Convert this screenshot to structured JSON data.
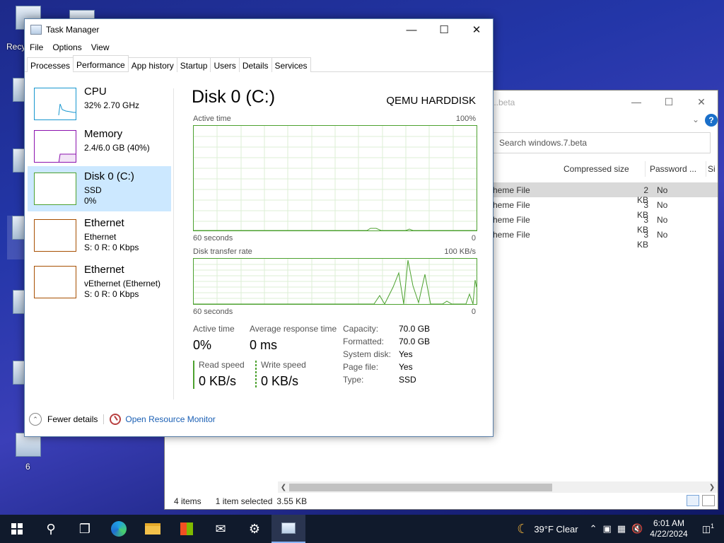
{
  "desktop": {
    "icons": [
      {
        "label": "Recy"
      },
      {
        "label": "6"
      }
    ]
  },
  "explorer": {
    "title": "...beta",
    "search_placeholder": "Search windows.7.beta",
    "columns": [
      "Compressed size",
      "Password ...",
      "Si"
    ],
    "rows": [
      {
        "type": "heme File",
        "size": "2 KB",
        "password": "No"
      },
      {
        "type": "heme File",
        "size": "3 KB",
        "password": "No"
      },
      {
        "type": "heme File",
        "size": "3 KB",
        "password": "No"
      },
      {
        "type": "heme File",
        "size": "3 KB",
        "password": "No"
      }
    ],
    "status": {
      "items": "4 items",
      "selected": "1 item selected",
      "size": "3.55 KB"
    }
  },
  "taskmanager": {
    "title": "Task Manager",
    "menu": [
      "File",
      "Options",
      "View"
    ],
    "tabs": [
      "Processes",
      "Performance",
      "App history",
      "Startup",
      "Users",
      "Details",
      "Services"
    ],
    "active_tab": "Performance",
    "sidebar": [
      {
        "name": "CPU",
        "line1": "32%  2.70 GHz",
        "line2": "",
        "color": "#1796cf"
      },
      {
        "name": "Memory",
        "line1": "2.4/6.0 GB (40%)",
        "line2": "",
        "color": "#8b12ae"
      },
      {
        "name": "Disk 0 (C:)",
        "line1": "SSD",
        "line2": "0%",
        "color": "#4ca12f"
      },
      {
        "name": "Ethernet",
        "line1": "Ethernet",
        "line2": "S: 0  R: 0 Kbps",
        "color": "#a74f01"
      },
      {
        "name": "Ethernet",
        "line1": "vEthernet (Ethernet)",
        "line2": "S: 0  R: 0 Kbps",
        "color": "#a74f01"
      }
    ],
    "main": {
      "title": "Disk 0 (C:)",
      "model": "QEMU HARDDISK",
      "graph1": {
        "label": "Active time",
        "max": "100%",
        "bottom_left": "60 seconds",
        "bottom_right": "0"
      },
      "graph2": {
        "label": "Disk transfer rate",
        "max": "100 KB/s",
        "bottom_left": "60 seconds",
        "bottom_right": "0"
      },
      "stats": {
        "active_time_label": "Active time",
        "active_time": "0%",
        "avg_resp_label": "Average response time",
        "avg_resp": "0 ms",
        "read_label": "Read speed",
        "read": "0 KB/s",
        "write_label": "Write speed",
        "write": "0 KB/s"
      },
      "props": [
        {
          "k": "Capacity:",
          "v": "70.0 GB"
        },
        {
          "k": "Formatted:",
          "v": "70.0 GB"
        },
        {
          "k": "System disk:",
          "v": "Yes"
        },
        {
          "k": "Page file:",
          "v": "Yes"
        },
        {
          "k": "Type:",
          "v": "SSD"
        }
      ]
    },
    "footer": {
      "fewer": "Fewer details",
      "resmon": "Open Resource Monitor"
    }
  },
  "taskbar": {
    "weather": "39°F  Clear",
    "time": "6:01 AM",
    "date": "4/22/2024",
    "notifications": "1"
  },
  "colors": {
    "disk_green": "#4ca12f",
    "selection": "#cce8ff"
  }
}
